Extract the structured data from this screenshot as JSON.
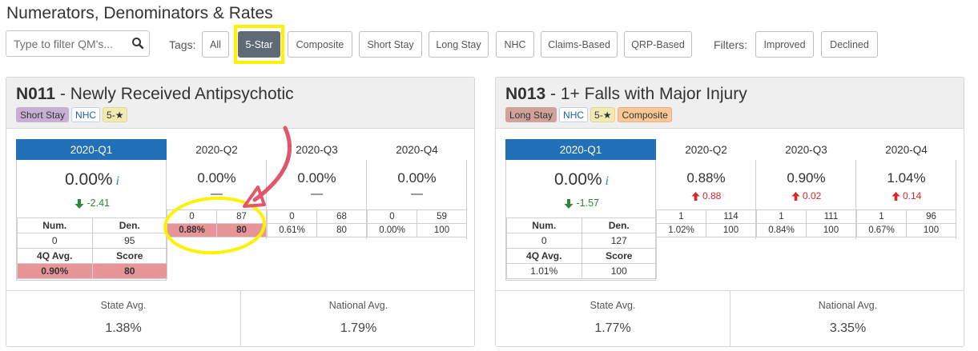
{
  "page": {
    "title": "Numerators, Denominators & Rates"
  },
  "search": {
    "placeholder": "Type to filter QM's..."
  },
  "tags": {
    "label": "Tags:",
    "items": [
      {
        "label": "All",
        "active": false
      },
      {
        "label": "5-Star",
        "active": true
      },
      {
        "label": "Composite",
        "active": false
      },
      {
        "label": "Short Stay",
        "active": false
      },
      {
        "label": "Long Stay",
        "active": false
      },
      {
        "label": "NHC",
        "active": false
      },
      {
        "label": "Claims-Based",
        "active": false
      },
      {
        "label": "QRP-Based",
        "active": false
      }
    ]
  },
  "filters": {
    "label": "Filters:",
    "items": [
      {
        "label": "Improved"
      },
      {
        "label": "Declined"
      }
    ]
  },
  "colors": {
    "active_quarter": "#2170b8",
    "highlight_red": "#e8959a",
    "down_green": "#2a8a3a",
    "up_red": "#d9252b",
    "annotation": "#fff200",
    "arrow": "#e0566a"
  },
  "cards": [
    {
      "code": "N011",
      "title": " - Newly Received Antipsychotic",
      "badges": [
        "Short Stay",
        "NHC",
        "5-★"
      ],
      "current": {
        "quarter": "2020-Q1",
        "value": "0.00%",
        "info_icon": "i",
        "change": "-2.41",
        "change_direction": "down",
        "num_label": "Num.",
        "den_label": "Den.",
        "num": "0",
        "den": "95",
        "avg_label": "4Q Avg.",
        "score_label": "Score",
        "avg": "0.90%",
        "score": "80"
      },
      "quarters": [
        {
          "label": "2020-Q2",
          "value": "0.00%",
          "change": "—",
          "num": "0",
          "den": "87",
          "rate": "0.88%",
          "score": "80",
          "highlight": true
        },
        {
          "label": "2020-Q3",
          "value": "0.00%",
          "change": "—",
          "num": "0",
          "den": "68",
          "rate": "0.61%",
          "score": "80",
          "highlight": false
        },
        {
          "label": "2020-Q4",
          "value": "0.00%",
          "change": "—",
          "num": "0",
          "den": "59",
          "rate": "0.00%",
          "score": "100",
          "highlight": false
        }
      ],
      "state_avg_label": "State Avg.",
      "state_avg": "1.38%",
      "national_avg_label": "National Avg.",
      "national_avg": "1.79%"
    },
    {
      "code": "N013",
      "title": " - 1+ Falls with Major Injury",
      "badges": [
        "Long Stay",
        "NHC",
        "5-★",
        "Composite"
      ],
      "current": {
        "quarter": "2020-Q1",
        "value": "0.00%",
        "info_icon": "i",
        "change": "-1.57",
        "change_direction": "down",
        "num_label": "Num.",
        "den_label": "Den.",
        "num": "0",
        "den": "127",
        "avg_label": "4Q Avg.",
        "score_label": "Score",
        "avg": "1.01%",
        "score": "100"
      },
      "quarters": [
        {
          "label": "2020-Q2",
          "value": "0.88%",
          "change": "0.88",
          "num": "1",
          "den": "114",
          "rate": "1.02%",
          "score": "100"
        },
        {
          "label": "2020-Q3",
          "value": "0.90%",
          "change": "0.02",
          "num": "1",
          "den": "111",
          "rate": "0.84%",
          "score": "100"
        },
        {
          "label": "2020-Q4",
          "value": "1.04%",
          "change": "0.14",
          "num": "1",
          "den": "96",
          "rate": "0.67%",
          "score": "100"
        }
      ],
      "state_avg_label": "State Avg.",
      "state_avg": "1.77%",
      "national_avg_label": "National Avg.",
      "national_avg": "3.35%"
    }
  ]
}
